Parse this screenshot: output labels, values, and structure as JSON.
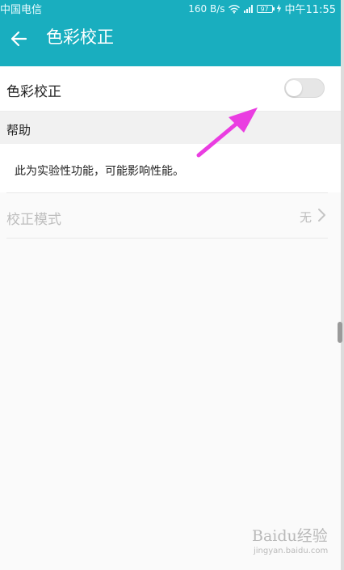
{
  "status_bar": {
    "carrier": "中国电信",
    "network_speed": "160 B/s",
    "battery": "97",
    "time": "中午11:55"
  },
  "app_bar": {
    "title": "色彩校正"
  },
  "main_setting": {
    "label": "色彩校正",
    "toggle_enabled": false
  },
  "help_section": {
    "title": "帮助",
    "description": "此为实验性功能，可能影响性能。"
  },
  "mode_setting": {
    "label": "校正模式",
    "value": "无"
  },
  "watermark": {
    "line1": "Baidu经验",
    "line2": "jingyan.baidu.com"
  },
  "colors": {
    "app_bar": "#19aebf",
    "annotation_arrow": "#ea3de1",
    "toggle_off": "#e6e6e6",
    "disabled_text": "#bdbdbd"
  },
  "icons": {
    "back": "arrow-left-icon",
    "wifi": "wifi-icon",
    "signal": "signal-icon",
    "battery": "battery-icon",
    "charging": "charging-icon",
    "chevron": "chevron-right-icon",
    "annotation": "annotation-arrow-icon"
  }
}
